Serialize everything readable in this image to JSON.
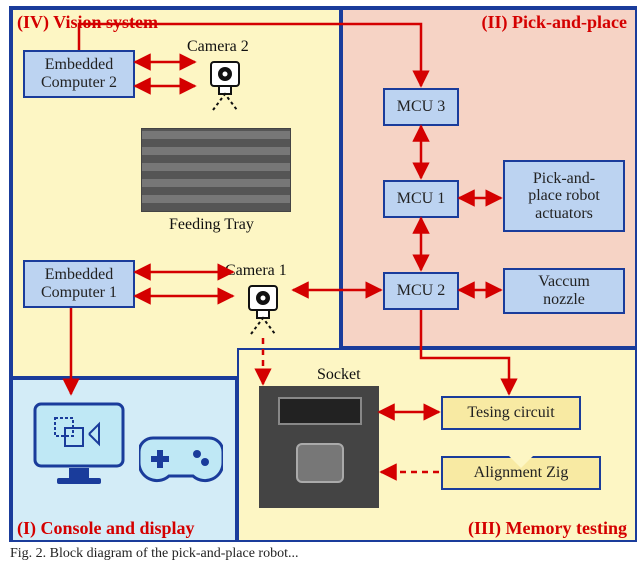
{
  "zones": {
    "vision": {
      "label": "(IV) Vision system"
    },
    "pick": {
      "label": "(II) Pick-and-place"
    },
    "console": {
      "label": "(I) Console and display"
    },
    "memory": {
      "label": "(III) Memory testing"
    }
  },
  "blocks": {
    "ec2": "Embedded\nComputer 2",
    "ec1": "Embedded\nComputer 1",
    "mcu3": "MCU 3",
    "mcu1": "MCU 1",
    "mcu2": "MCU 2",
    "act": "Pick-and-\nplace robot\nactuators",
    "nozzle": "Vaccum\nnozzle",
    "tc": "Tesing circuit",
    "jig": "Alignment Zig"
  },
  "labels": {
    "cam2": "Camera 2",
    "cam1": "Camera 1",
    "tray": "Feeding Tray",
    "socket": "Socket"
  },
  "caption": "Fig. 2.    Block diagram of the pick-and-place robot..."
}
